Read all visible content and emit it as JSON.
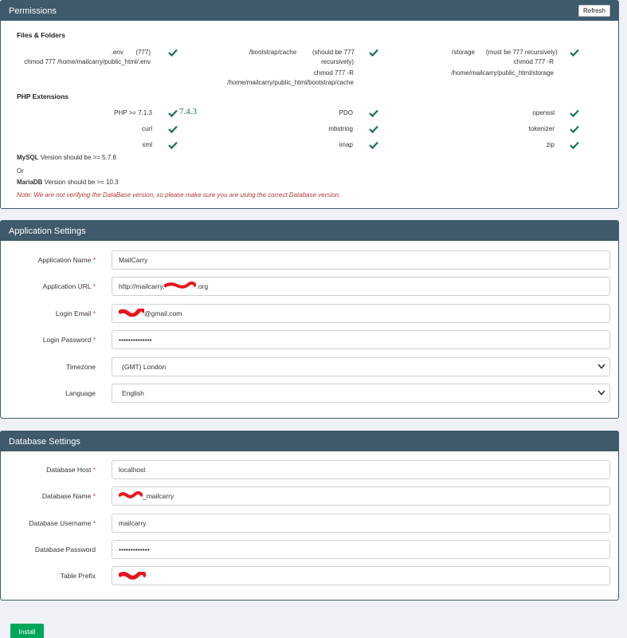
{
  "permissions": {
    "title": "Permissions",
    "refresh_label": "Refresh",
    "files_heading": "Files & Folders",
    "files": [
      {
        "path": ".env",
        "note": "(777)",
        "cmd": "chmod 777 /home/mailcarry/public_html/.env"
      },
      {
        "path": "/bootstrap/cache",
        "note": "(should be 777",
        "note2": "recursively)",
        "cmd": "chmod 777 -R",
        "cmd2": "/home/mailcarry/public_html/bootstrap/cache"
      },
      {
        "path": "/storage",
        "note": "(must be 777 recursively)",
        "cmd": "chmod 777 -R",
        "cmd2": "/home/mailcarry/public_html/storage"
      }
    ],
    "php_heading": "PHP Extensions",
    "php_version_label": "PHP >= 7.1.3",
    "php_version_value": "7.4.3",
    "extensions": [
      "PDO",
      "openssl",
      "curl",
      "mbstring",
      "tokenizer",
      "xml",
      "imap",
      "zip"
    ],
    "mysql_name": "MySQL",
    "mysql_text": " Version should be >= 5.7.8",
    "or_text": "Or",
    "mariadb_name": "MariaDB",
    "mariadb_text": " Version should be >= 10.3",
    "note": "Note: We are not verifying the DataBase version, so please make sure you are using the correct Database version."
  },
  "app_settings": {
    "title": "Application Settings",
    "fields": [
      {
        "label": "Application Name",
        "required": "*",
        "value": "MailCarry"
      },
      {
        "label": "Application URL",
        "required": "*",
        "value_prefix": "http://mailcarry.",
        "value_suffix": ".org"
      },
      {
        "label": "Login Email",
        "required": "*",
        "value_suffix": "@gmail.com"
      },
      {
        "label": "Login Password",
        "required": "*",
        "value": "••••••••••••••"
      },
      {
        "label": "Timezone",
        "value": "(GMT) London"
      },
      {
        "label": "Language",
        "value": "English"
      }
    ]
  },
  "db_settings": {
    "title": "Database Settings",
    "fields": [
      {
        "label": "Database Host",
        "required": "*",
        "value": "localhost"
      },
      {
        "label": "Database Name",
        "required": "*",
        "value_suffix": "_mailcarry"
      },
      {
        "label": "Database Username",
        "required": "*",
        "value": "mailcarry"
      },
      {
        "label": "Database Password",
        "value": "•••••••••••••"
      },
      {
        "label": "Table Prefix",
        "value": ""
      }
    ]
  },
  "install_label": "Install",
  "colors": {
    "header": "#3e5a6b",
    "check": "#1c6e5a",
    "install": "#00a65a",
    "note": "#b23a3a",
    "redaction": "#e8141c"
  },
  "icons": {
    "check": "check-icon",
    "select": "chevron-down-icon"
  }
}
